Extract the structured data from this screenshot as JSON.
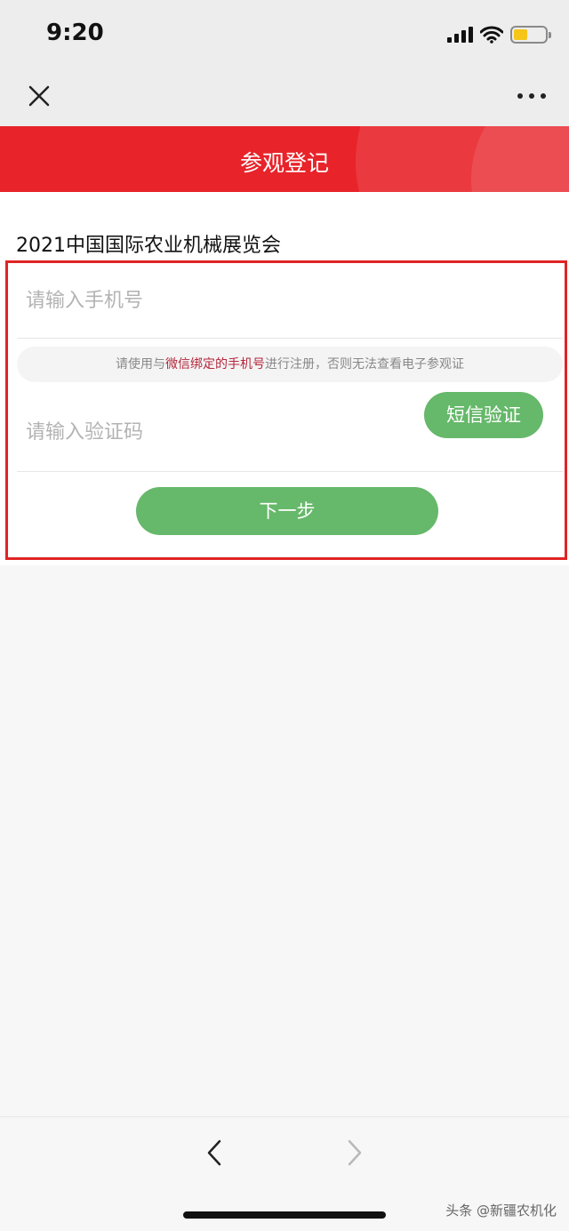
{
  "status_bar": {
    "time": "9:20",
    "battery_level": 0.45
  },
  "nav": {
    "close_icon": "close-icon",
    "more_icon": "more-icon"
  },
  "header": {
    "title": "参观登记",
    "color": "#e8232a"
  },
  "form": {
    "exhibition_title": "2021中国国际农业机械展览会",
    "phone_placeholder": "请输入手机号",
    "notice_prefix": "请使用与",
    "notice_highlight": "微信绑定的手机号",
    "notice_suffix": "进行注册，否则无法查看电子参观证",
    "code_placeholder": "请输入验证码",
    "sms_button_label": "短信验证",
    "next_button_label": "下一步",
    "button_color": "#66b86a",
    "highlight_color": "#e02424"
  },
  "bottom_bar": {
    "back_icon": "chevron-left-icon",
    "forward_icon": "chevron-right-icon"
  },
  "watermark": "头条 @新疆农机化"
}
